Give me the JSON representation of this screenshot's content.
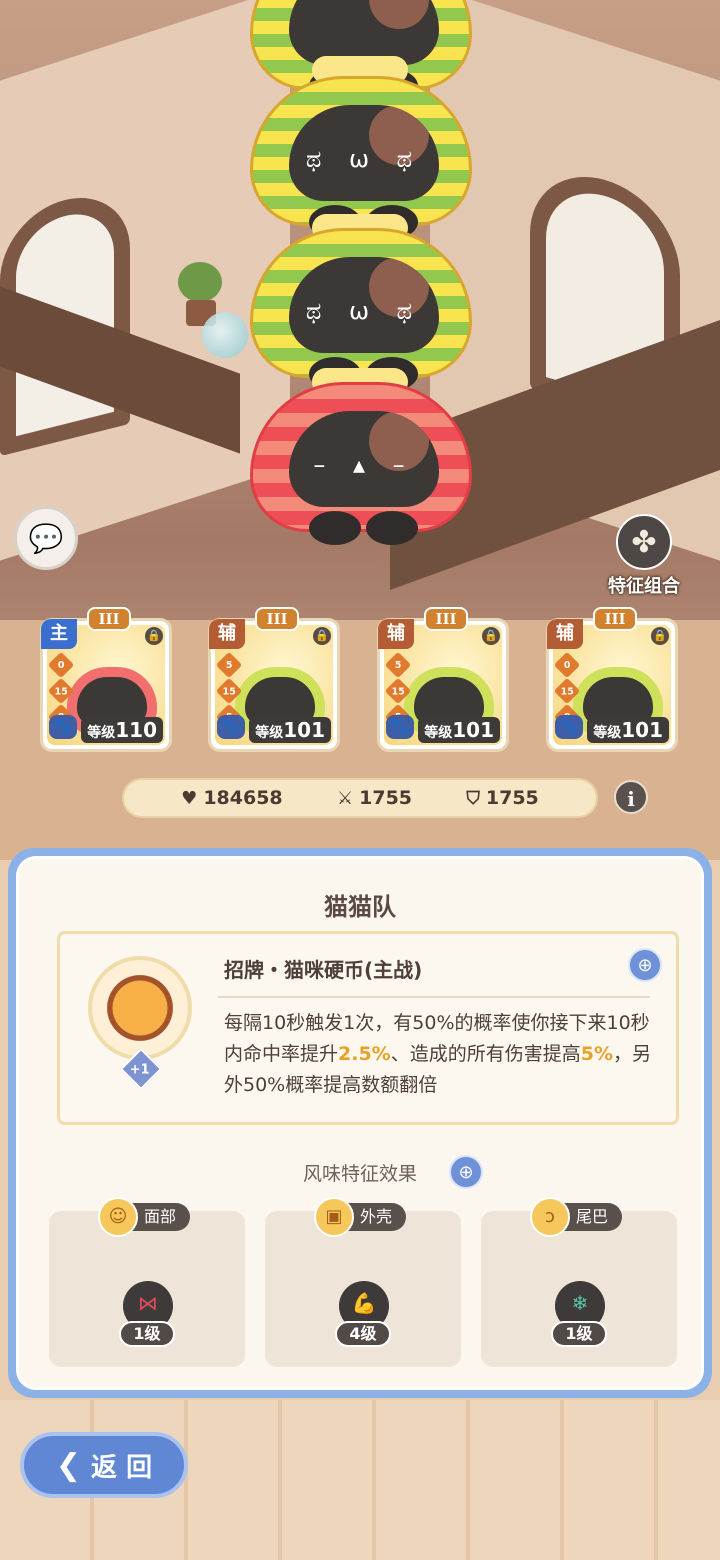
{
  "side_buttons": {
    "trait_combo_label": "特征组合"
  },
  "cards": [
    {
      "rank": "III",
      "role": "主",
      "stats": [
        "0",
        "15",
        "0"
      ],
      "level_prefix": "等级",
      "level": "110",
      "body_color": "red"
    },
    {
      "rank": "III",
      "role": "辅",
      "stats": [
        "5",
        "15",
        "5"
      ],
      "level_prefix": "等级",
      "level": "101",
      "body_color": "yellow"
    },
    {
      "rank": "III",
      "role": "辅",
      "stats": [
        "5",
        "15",
        "5"
      ],
      "level_prefix": "等级",
      "level": "101",
      "body_color": "yellow"
    },
    {
      "rank": "III",
      "role": "辅",
      "stats": [
        "0",
        "15",
        "0"
      ],
      "level_prefix": "等级",
      "level": "101",
      "body_color": "yellow"
    }
  ],
  "team_stats": {
    "hp": "184658",
    "attack": "1755",
    "defense": "1755"
  },
  "panel": {
    "title": "猫猫队",
    "skill": {
      "name": "招牌・猫咪硬币(主战)",
      "plus": "+1",
      "desc_parts": [
        "每隔10秒触发1次，有50%的概率使你接下来10秒内命中率提升",
        "2.5%",
        "、造成的所有伤害提高",
        "5%",
        "，另外50%概率提高数额翻倍"
      ]
    },
    "flavor_title": "风味特征效果",
    "slots": [
      {
        "label": "面部",
        "level": "1级",
        "icon": "bow-icon"
      },
      {
        "label": "外壳",
        "level": "4级",
        "icon": "arm-icon"
      },
      {
        "label": "尾巴",
        "level": "1级",
        "icon": "snowflake-icon"
      }
    ]
  },
  "back_button": {
    "label": "返 回"
  },
  "colors": {
    "accent_blue": "#6f91d8",
    "highlight_orange": "#e8a22a",
    "text_brown": "#4e4039"
  }
}
